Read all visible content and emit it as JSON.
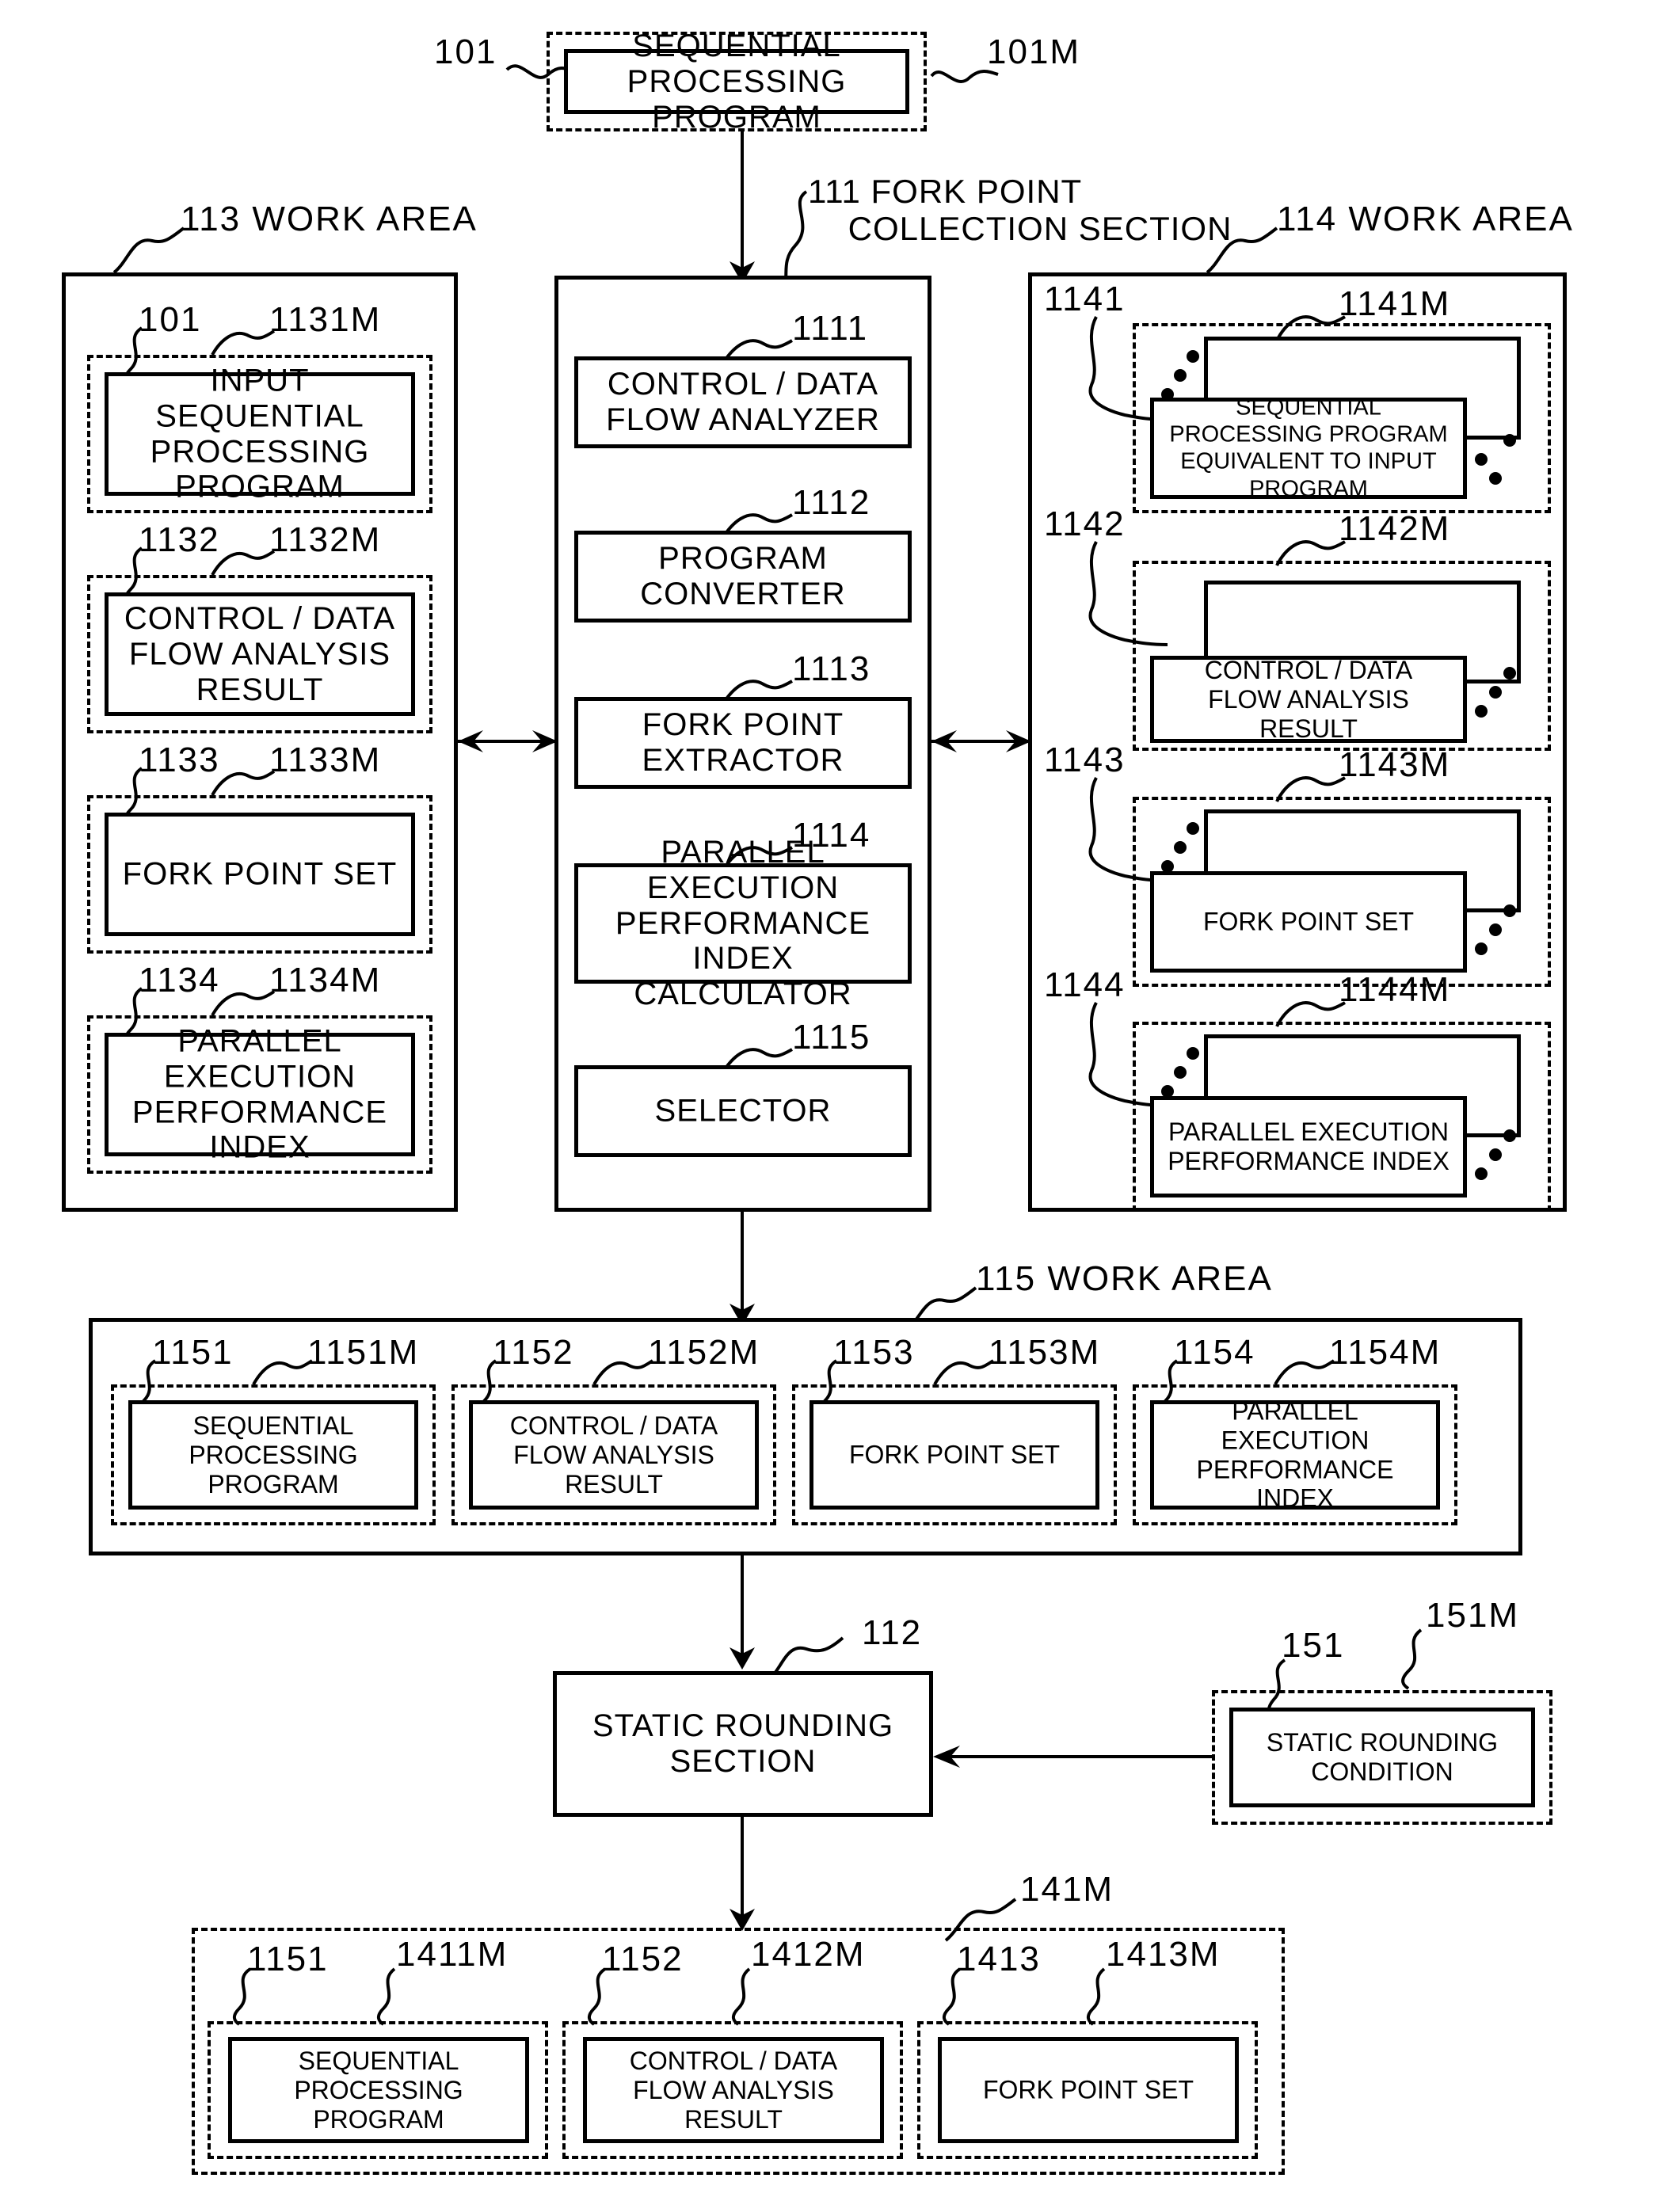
{
  "figure": {
    "type": "patent-block-diagram",
    "title_block": {
      "ref_left": "101",
      "ref_right": "101M",
      "label": "SEQUENTIAL\nPROCESSING PROGRAM"
    },
    "center_section": {
      "callout": "111 FORK POINT\n    COLLECTION SECTION",
      "modules": [
        {
          "ref": "1111",
          "label": "CONTROL / DATA\nFLOW ANALYZER"
        },
        {
          "ref": "1112",
          "label": "PROGRAM\nCONVERTER"
        },
        {
          "ref": "1113",
          "label": "FORK POINT\nEXTRACTOR"
        },
        {
          "ref": "1114",
          "label": "PARALLEL EXECUTION\nPERFORMANCE INDEX\nCALCULATOR"
        },
        {
          "ref": "1115",
          "label": "SELECTOR"
        }
      ]
    },
    "work_area_113": {
      "callout": "113 WORK AREA",
      "items": [
        {
          "ref_left": "101",
          "ref_right": "1131M",
          "label": "INPUT SEQUENTIAL\nPROCESSING\nPROGRAM"
        },
        {
          "ref_left": "1132",
          "ref_right": "1132M",
          "label": "CONTROL / DATA\nFLOW ANALYSIS\nRESULT"
        },
        {
          "ref_left": "1133",
          "ref_right": "1133M",
          "label": "FORK POINT SET"
        },
        {
          "ref_left": "1134",
          "ref_right": "1134M",
          "label": "PARALLEL EXECUTION\nPERFORMANCE\nINDEX"
        }
      ]
    },
    "work_area_114": {
      "callout": "114 WORK AREA",
      "items": [
        {
          "ref_left": "1141",
          "ref_right": "1141M",
          "label": "SEQUENTIAL PROCESSING PROGRAM\nEQUIVALENT TO INPUT PROGRAM"
        },
        {
          "ref_left": "1142",
          "ref_right": "1142M",
          "label": "CONTROL / DATA\nFLOW ANALYSIS RESULT"
        },
        {
          "ref_left": "1143",
          "ref_right": "1143M",
          "label": "FORK POINT SET"
        },
        {
          "ref_left": "1144",
          "ref_right": "1144M",
          "label": "PARALLEL EXECUTION\nPERFORMANCE INDEX"
        }
      ]
    },
    "work_area_115": {
      "callout": "115 WORK AREA",
      "items": [
        {
          "ref_left": "1151",
          "ref_right": "1151M",
          "label": "SEQUENTIAL\nPROCESSING\nPROGRAM"
        },
        {
          "ref_left": "1152",
          "ref_right": "1152M",
          "label": "CONTROL / DATA\nFLOW ANALYSIS\nRESULT"
        },
        {
          "ref_left": "1153",
          "ref_right": "1153M",
          "label": "FORK POINT SET"
        },
        {
          "ref_left": "1154",
          "ref_right": "1154M",
          "label": "PARALLEL EXECUTION\nPERFORMANCE\nINDEX"
        }
      ]
    },
    "static_rounding": {
      "ref": "112",
      "label": "STATIC ROUNDING\nSECTION"
    },
    "static_rounding_condition": {
      "ref_left": "151",
      "ref_right": "151M",
      "label": "STATIC ROUNDING\nCONDITION"
    },
    "output_141M": {
      "callout": "141M",
      "items": [
        {
          "ref_left": "1151",
          "ref_right": "1411M",
          "label": "SEQUENTIAL\nPROCESSING\nPROGRAM"
        },
        {
          "ref_left": "1152",
          "ref_right": "1412M",
          "label": "CONTROL / DATA\nFLOW ANALYSIS\nRESULT"
        },
        {
          "ref_left": "1413",
          "ref_right": "1413M",
          "label": "FORK POINT SET"
        }
      ]
    },
    "colors": {
      "ink": "#000000",
      "paper": "#ffffff"
    }
  }
}
